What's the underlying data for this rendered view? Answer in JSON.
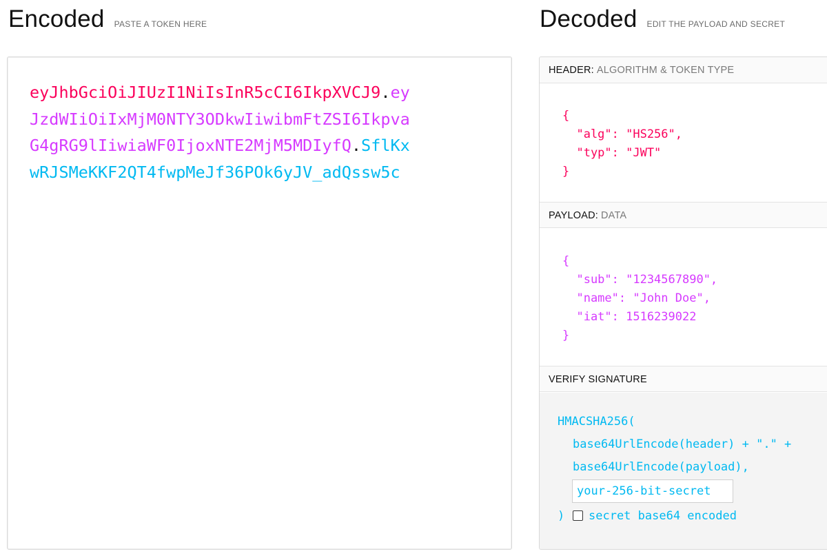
{
  "encoded": {
    "title": "Encoded",
    "subtitle": "PASTE A TOKEN HERE",
    "token_lines": [
      [
        {
          "t": "eyJhbGciOiJIUzI1NiIsInR5cCI6IkpXVCJ9",
          "c": "red"
        },
        {
          "t": ".",
          "c": "dot"
        },
        {
          "t": "ey",
          "c": "purple"
        }
      ],
      [
        {
          "t": "JzdWIiOiIxMjM0NTY3ODkwIiwibmFtZSI6Ikpva",
          "c": "purple"
        }
      ],
      [
        {
          "t": "G4gRG9lIiwiaWF0IjoxNTE2MjM5MDIyfQ",
          "c": "purple"
        },
        {
          "t": ".",
          "c": "dot"
        },
        {
          "t": "SflKx",
          "c": "blue"
        }
      ],
      [
        {
          "t": "wRJSMeKKF2QT4fwpMeJf36POk6yJV_adQssw5c",
          "c": "blue"
        }
      ]
    ]
  },
  "decoded": {
    "title": "Decoded",
    "subtitle": "EDIT THE PAYLOAD AND SECRET",
    "header": {
      "label": "HEADER:",
      "desc": "ALGORITHM & TOKEN TYPE",
      "json": "{\n  \"alg\": \"HS256\",\n  \"typ\": \"JWT\"\n}"
    },
    "payload": {
      "label": "PAYLOAD:",
      "desc": "DATA",
      "json": "{\n  \"sub\": \"1234567890\",\n  \"name\": \"John Doe\",\n  \"iat\": 1516239022\n}"
    },
    "verify": {
      "label": "VERIFY SIGNATURE",
      "line1": "HMACSHA256(",
      "line2": "base64UrlEncode(header) + \".\" +",
      "line3": "base64UrlEncode(payload),",
      "secret_placeholder": "your-256-bit-secret",
      "secret_value": "",
      "close": ")",
      "checkbox_label": "secret base64 encoded",
      "checkbox_checked": false
    }
  },
  "colors": {
    "header": "#fb015b",
    "payload": "#d63aff",
    "signature": "#00b9f1",
    "dot": "#111111"
  }
}
